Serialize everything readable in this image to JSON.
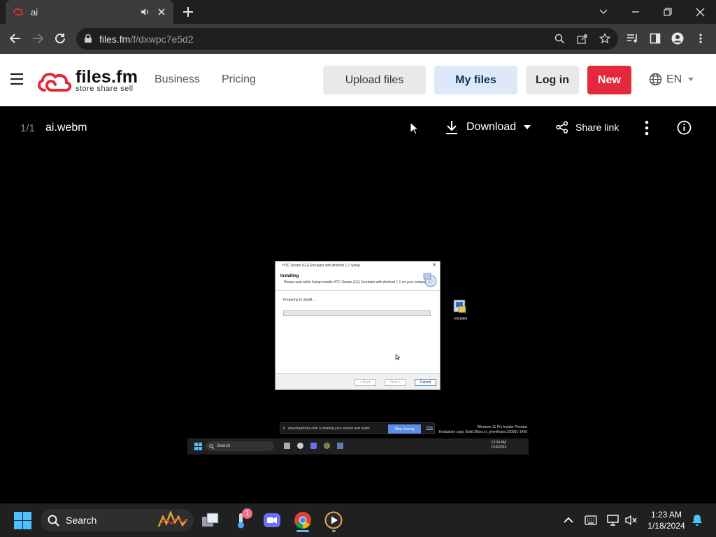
{
  "browser": {
    "tab_title": "ai",
    "url_host": "files.fm",
    "url_path": "/f/dxwpc7e5d2"
  },
  "site": {
    "logo_name": "files.fm",
    "logo_tagline": "store  share  sell",
    "nav": [
      "Business",
      "Pricing"
    ],
    "buttons": {
      "upload": "Upload files",
      "myfiles": "My files",
      "login": "Log in",
      "new": "New"
    },
    "language": "EN",
    "brand_color": "#e5293a"
  },
  "viewer": {
    "counter": "1/1",
    "filename": "ai.webm",
    "download_label": "Download",
    "share_label": "Share link"
  },
  "video": {
    "dialog_title": "HTC Dream (G1) Emulator with Android 1.1 Setup",
    "heading": "Installing",
    "subheading": "Please wait while Setup installs HTC Dream (G1) Emulator with Android 1.1 on your computer.",
    "status": "Preparing to install...",
    "back_label": "< Back",
    "next_label": "Next >",
    "cancel_label": "Cancel",
    "desktop_icon_label": "emulator",
    "share_message": "www.tupiclicks.com is sharing your screen and audio.",
    "stop_sharing": "Stop sharing",
    "hide": "Hide",
    "watermark_line1": "Windows 11 Pro Insider Preview",
    "watermark_line2": "Evaluation copy. Build 26xxx.rs_prerelease.230901-1436",
    "inner_search": "Search",
    "inner_time": "12:34 AM",
    "inner_date": "1/18/2024"
  },
  "taskbar": {
    "search_placeholder": "Search",
    "time": "1:23 AM",
    "date": "1/18/2024",
    "badge_count": "1"
  }
}
